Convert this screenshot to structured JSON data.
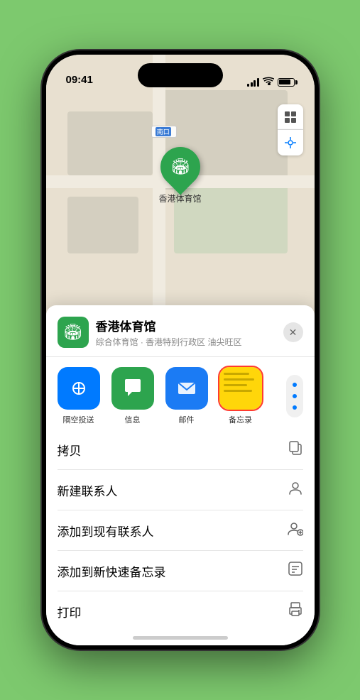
{
  "status_bar": {
    "time": "09:41",
    "nav_arrow": "▶"
  },
  "map": {
    "nankou_label": "南口",
    "nankou_abbr": "南口",
    "stadium_name": "香港体育馆",
    "stadium_emoji": "🏟"
  },
  "venue": {
    "name": "香港体育馆",
    "subtitle": "综合体育馆 · 香港特别行政区 油尖旺区",
    "icon_emoji": "🏟"
  },
  "share_apps": [
    {
      "id": "airdrop",
      "label": "隔空投送",
      "emoji": "📡"
    },
    {
      "id": "message",
      "label": "信息",
      "emoji": "💬"
    },
    {
      "id": "mail",
      "label": "邮件",
      "emoji": "✉️"
    },
    {
      "id": "notes",
      "label": "备忘录"
    }
  ],
  "actions": [
    {
      "id": "copy",
      "label": "拷贝",
      "icon": "📋"
    },
    {
      "id": "add-contact",
      "label": "新建联系人",
      "icon": "👤"
    },
    {
      "id": "add-existing",
      "label": "添加到现有联系人",
      "icon": "👥"
    },
    {
      "id": "add-note",
      "label": "添加到新快速备忘录",
      "icon": "📝"
    },
    {
      "id": "print",
      "label": "打印",
      "icon": "🖨"
    }
  ]
}
